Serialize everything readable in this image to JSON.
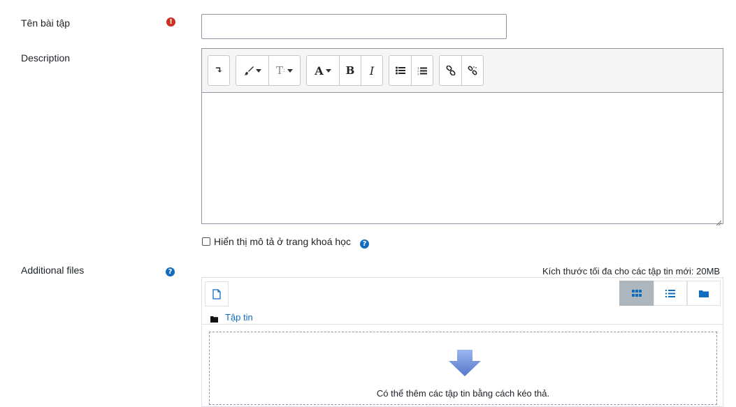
{
  "form": {
    "name_field": {
      "label": "Tên bài tập",
      "value": "",
      "required_icon": "exclamation-circle-icon"
    },
    "description": {
      "label": "Description",
      "content": "",
      "toolbar": [
        {
          "group": "expand",
          "buttons": [
            {
              "icon": "toolbar-toggle-icon",
              "glyph": "↴"
            }
          ]
        },
        {
          "group": "style",
          "buttons": [
            {
              "icon": "paintbrush-icon",
              "glyph": "🖌"
            },
            {
              "icon": "font-style-icon",
              "glyph": "Tᵢ"
            }
          ]
        },
        {
          "group": "text",
          "buttons": [
            {
              "icon": "font-color-icon",
              "glyph": "A"
            },
            {
              "icon": "bold-icon",
              "glyph": "B"
            },
            {
              "icon": "italic-icon",
              "glyph": "I"
            }
          ]
        },
        {
          "group": "lists",
          "buttons": [
            {
              "icon": "unordered-list-icon",
              "glyph": "☰"
            },
            {
              "icon": "ordered-list-icon",
              "glyph": "☰"
            }
          ]
        },
        {
          "group": "links",
          "buttons": [
            {
              "icon": "link-icon",
              "glyph": "🔗"
            },
            {
              "icon": "unlink-icon",
              "glyph": "⛓"
            }
          ]
        }
      ]
    },
    "show_description": {
      "label": "Hiển thị mô tả ở trang khoá học",
      "checked": false,
      "help_icon": "question-circle-icon"
    },
    "additional_files": {
      "label": "Additional files",
      "help_icon": "question-circle-icon",
      "max_size_text": "Kích thước tối đa cho các tập tin mới: 20MB",
      "add_file_icon": "file-add-icon",
      "views": [
        {
          "name": "icons-view",
          "icon": "grid-icon",
          "active": true
        },
        {
          "name": "list-view",
          "icon": "list-icon",
          "active": false
        },
        {
          "name": "tree-view",
          "icon": "folder-icon",
          "active": false
        }
      ],
      "path_label": "Tập tin",
      "drop_text": "Có thể thêm các tập tin bằng cách kéo thả."
    }
  },
  "colors": {
    "required": "#ca3120",
    "help": "#0f6cbf",
    "link": "#0f6cbf",
    "drop_arrow": "#6b8cdc"
  }
}
